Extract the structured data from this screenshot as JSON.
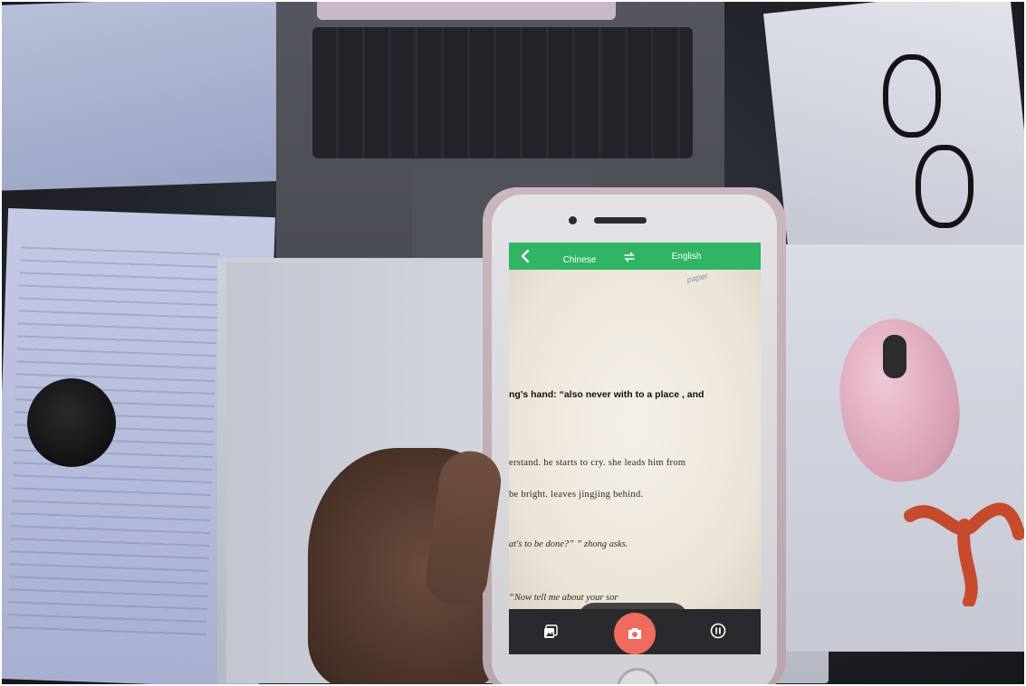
{
  "app": {
    "top_bar": {
      "source_language": "Chinese",
      "target_language": "English",
      "back_icon": "chevron-left-icon",
      "swap_icon": "swap-arrows-icon"
    },
    "camera_view": {
      "handwritten_note": "paper",
      "lines": [
        {
          "text": "ng's hand: “also never with to a place , and",
          "style": "bold"
        },
        {
          "text": "erstand. he starts to cry. she leads him from",
          "style": "book"
        },
        {
          "text": "be bright. leaves jingjing behind.",
          "style": "book"
        },
        {
          "text": "at's to be done?” ” zhong asks.",
          "style": "ital"
        },
        {
          "text": "“Now tell me about your sor",
          "style": "ital"
        }
      ]
    },
    "overlay_controls": [
      {
        "name": "eye-icon"
      },
      {
        "name": "flash-off-icon"
      },
      {
        "name": "scan-frame-icon"
      }
    ],
    "bottom_bar": {
      "gallery_icon": "gallery-icon",
      "shutter_icon": "camera-icon",
      "pause_icon": "pause-icon"
    },
    "colors": {
      "accent_green": "#2fb563",
      "shutter_red": "#f06a5e",
      "bar_dark": "#2a2a2e"
    }
  }
}
